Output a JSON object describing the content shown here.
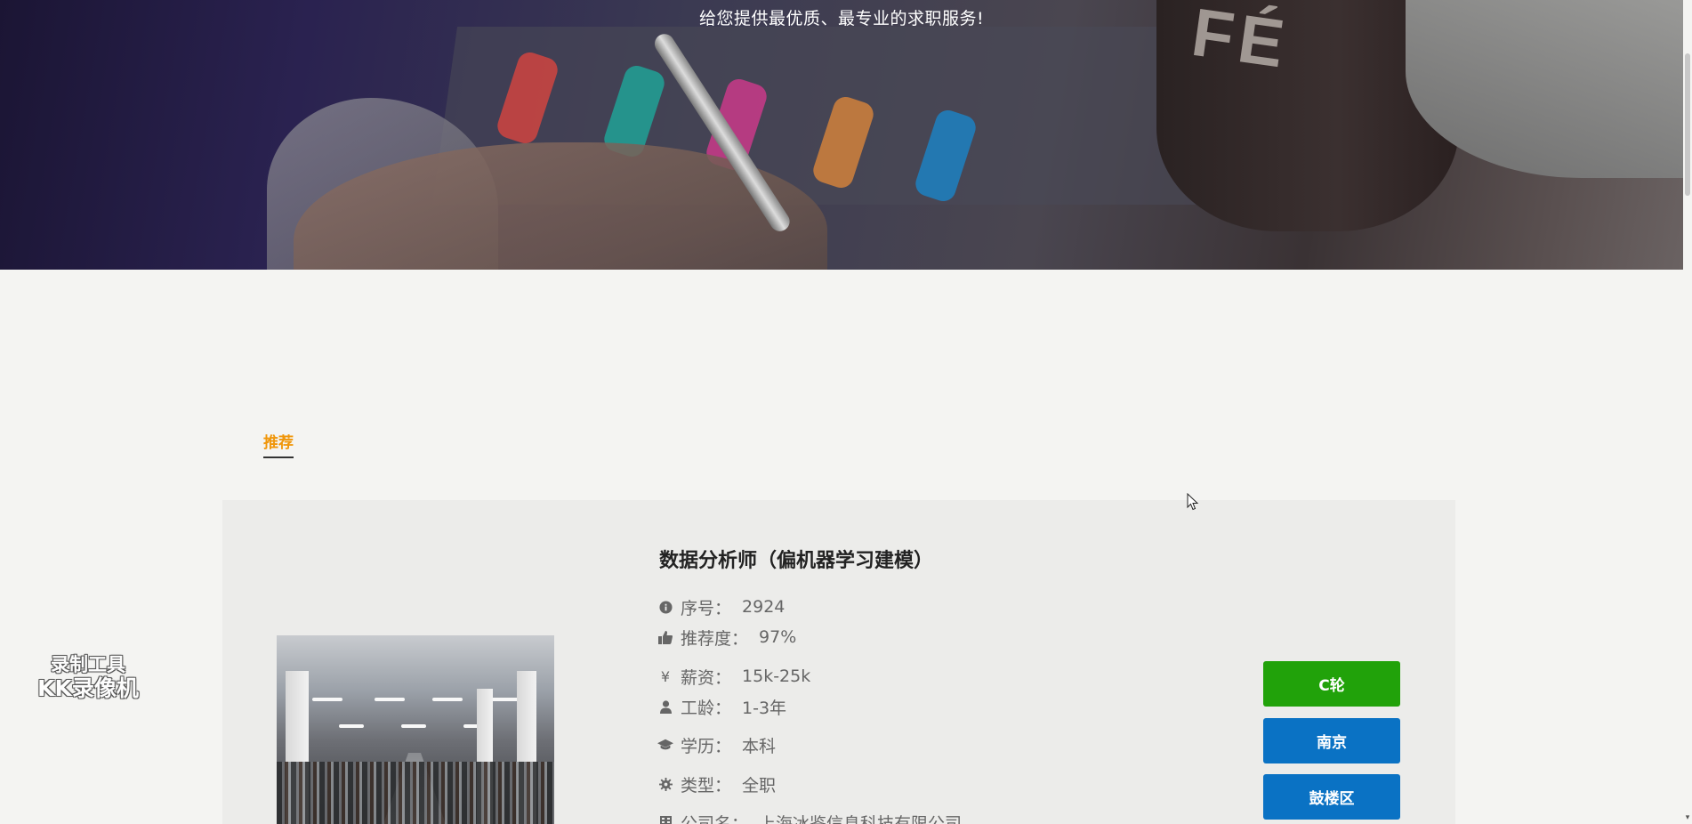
{
  "hero": {
    "slogan": "给您提供最优质、最专业的求职服务!",
    "cup_text": "FÉ"
  },
  "tabs": {
    "recommend_label": "推荐"
  },
  "job": {
    "title": "数据分析师（偏机器学习建模）",
    "fields": {
      "id": {
        "label": "序号：",
        "value": "2924",
        "icon": "info-circle-icon"
      },
      "recommend": {
        "label": "推荐度：",
        "value": "97%",
        "icon": "thumbs-up-icon"
      },
      "salary": {
        "label": "薪资：",
        "value": "15k-25k",
        "icon": "yen-icon"
      },
      "experience": {
        "label": "工龄：",
        "value": "1-3年",
        "icon": "user-icon"
      },
      "education": {
        "label": "学历：",
        "value": "本科",
        "icon": "graduation-cap-icon"
      },
      "type": {
        "label": "类型：",
        "value": "全职",
        "icon": "gear-icon"
      },
      "company": {
        "label": "公司名：",
        "value": "上海冰鉴信息科技有限公司",
        "icon": "building-icon"
      }
    },
    "tags": {
      "funding": "C轮",
      "city": "南京",
      "district": "鼓楼区"
    }
  },
  "watermark": {
    "line1": "录制工具",
    "line2": "KK录像机"
  },
  "colors": {
    "tab_active": "#f0960a",
    "tag_green": "#21a20a",
    "tag_blue": "#0a72c4",
    "page_bg": "#f4f4f2"
  }
}
